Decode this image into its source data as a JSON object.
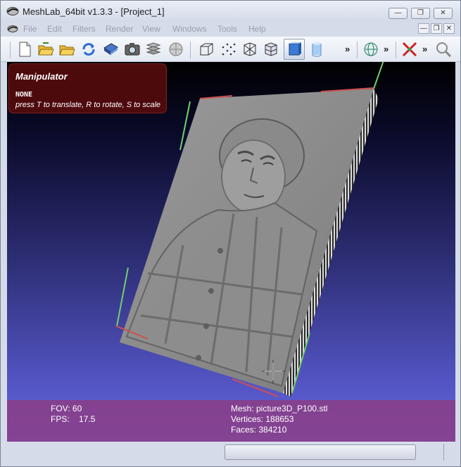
{
  "window": {
    "title": "MeshLab_64bit v1.3.3 - [Project_1]",
    "minimize_glyph": "—",
    "maximize_glyph": "❐",
    "close_glyph": "✕"
  },
  "menu": {
    "items": [
      "File",
      "Edit",
      "Filters",
      "Render",
      "View",
      "Windows",
      "Tools",
      "Help"
    ],
    "mdi_minimize_glyph": "—",
    "mdi_restore_glyph": "❐",
    "mdi_close_glyph": "✕"
  },
  "toolbar": {
    "more_glyph": "»",
    "icons": [
      "new-project-icon",
      "open-project-icon",
      "open-mesh-icon",
      "reload-icon",
      "save-icon",
      "snapshot-icon",
      "layers-icon",
      "texture-icon",
      "bounding-box-icon",
      "points-icon",
      "wireframe-icon",
      "hidden-lines-icon",
      "flat-shading-icon",
      "smooth-shading-icon",
      "globe-icon",
      "manipulator-icon",
      "zoom-icon"
    ]
  },
  "manipulator": {
    "title": "Manipulator",
    "mode": "NONE",
    "hint": "press T to translate, R to rotate, S to scale"
  },
  "viewport_info": {
    "fov": "FOV: 60",
    "fps": "FPS:    17.5",
    "mesh": "Mesh: picture3D_P100.stl",
    "vertices": "Vertices: 188653",
    "faces": "Faces: 384210"
  },
  "colors": {
    "viewport_top": "#000000",
    "viewport_bottom": "#6466dc",
    "info_bar": "#8c3c82",
    "manipulator_box": "#5a0c0c"
  }
}
